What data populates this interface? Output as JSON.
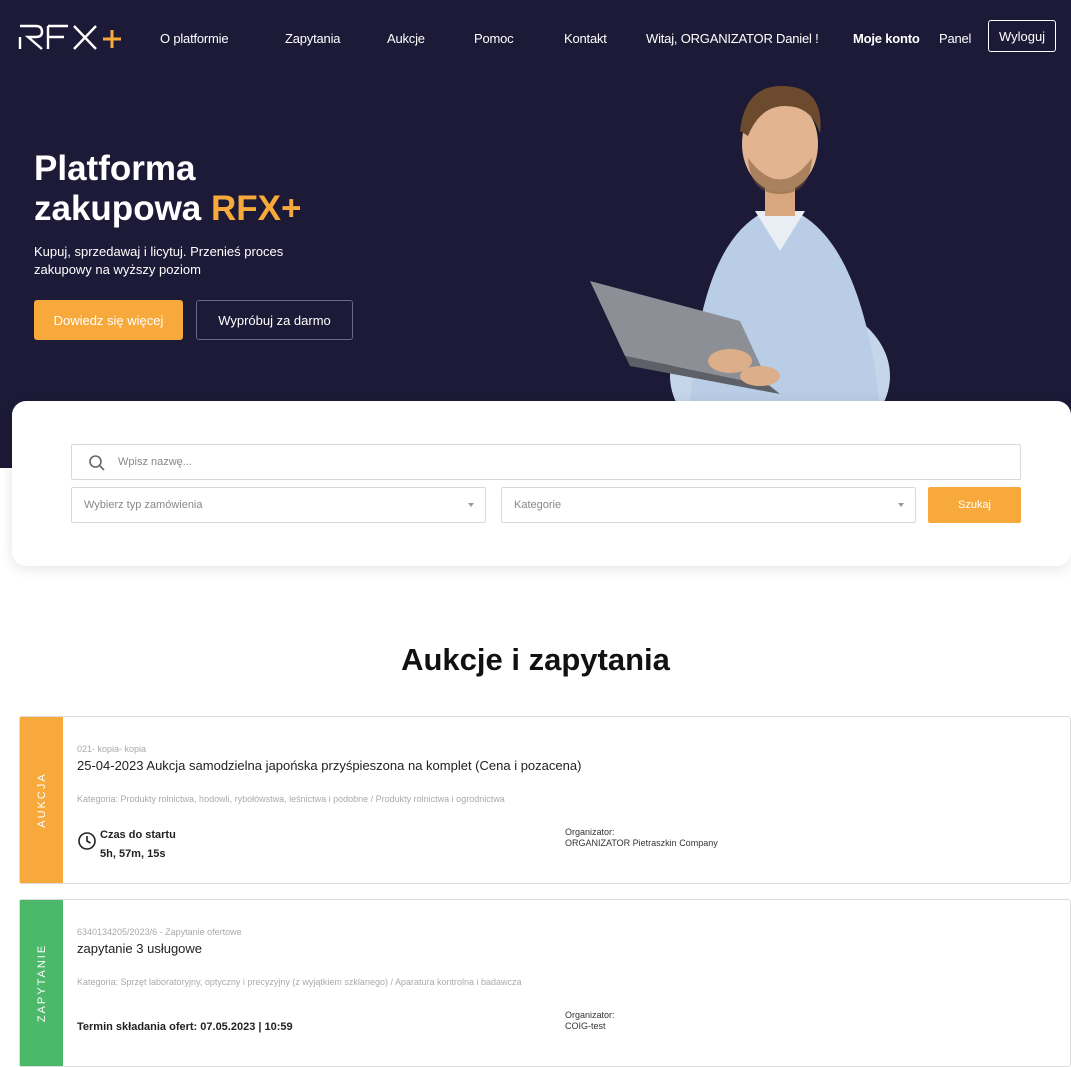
{
  "nav": {
    "logo_text": "RFX+",
    "links": [
      "O platformie",
      "Zapytania",
      "Aukcje",
      "Pomoc",
      "Kontakt"
    ],
    "greeting": "Witaj, ORGANIZATOR Daniel !",
    "my_account": "Moje konto",
    "panel": "Panel",
    "logout": "Wyloguj"
  },
  "hero": {
    "title_line1": "Platforma",
    "title_line2": "zakupowa",
    "title_accent": "RFX+",
    "subtitle": "Kupuj, sprzedawaj i licytuj. Przenieś proces zakupowy na wyższy poziom",
    "btn_primary": "Dowiedz się więcej",
    "btn_secondary": "Wypróbuj za darmo"
  },
  "search": {
    "placeholder": "Wpisz nazwę...",
    "type_placeholder": "Wybierz typ zamówienia",
    "category_placeholder": "Kategorie",
    "button": "Szukaj"
  },
  "section": {
    "title": "Aukcje i zapytania"
  },
  "listings": [
    {
      "band": "AUKCJA",
      "band_color": "#f8a93c",
      "code": "021- kopia- kopia",
      "title": "25-04-2023 Aukcja samodzielna japońska przyśpieszona na komplet (Cena i pozacena)",
      "category": "Kategoria: Produkty rolnictwa, hodowli, rybołówstwa, leśnictwa i podobne / Produkty rolnictwa i ogrodnictwa",
      "timer_label": "Czas do startu",
      "timer_value": "5h, 57m, 15s",
      "organizer_label": "Organizator:",
      "organizer_name": "ORGANIZATOR Pietraszkin Company"
    },
    {
      "band": "ZAPYTANIE",
      "band_color": "#4cb86a",
      "code": "6340134205/2023/6 - Zapytanie ofertowe",
      "title": "zapytanie 3 usługowe",
      "category": "Kategoria: Sprzęt laboratoryjny, optyczny i precyzyjny (z wyjątkiem szklanego) / Aparatura kontrolna i badawcza",
      "deadline": "Termin składania ofert: 07.05.2023 | 10:59",
      "organizer_label": "Organizator:",
      "organizer_name": "COIG-test"
    }
  ],
  "colors": {
    "hero_bg": "#1c1a36",
    "accent": "#f8a93c",
    "green": "#4cb86a"
  }
}
